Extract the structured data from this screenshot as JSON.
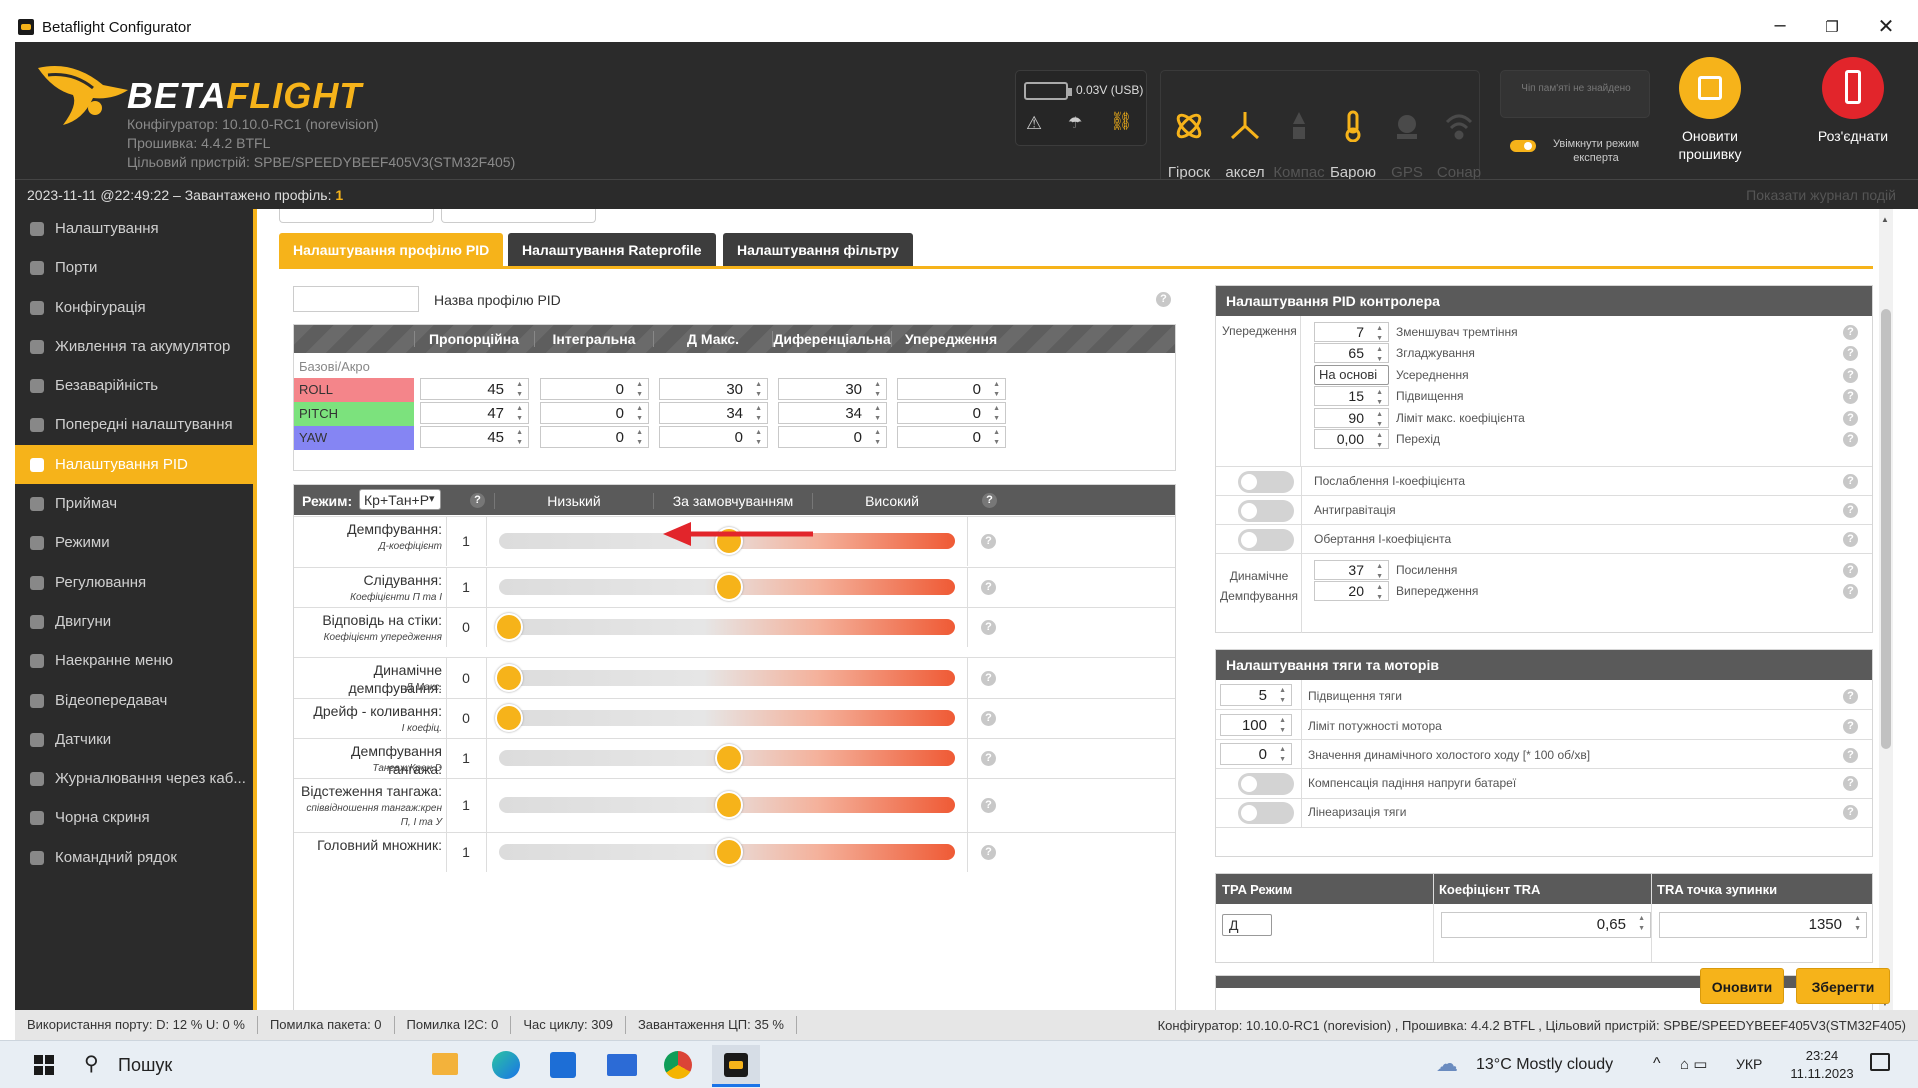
{
  "window": {
    "title": "Betaflight Configurator",
    "minimize": "–",
    "restore": "❐",
    "close": "✕"
  },
  "header": {
    "brand_first": "BETA",
    "brand_second": "FLIGHT",
    "configurator": "Конфігуратор: 10.10.0-RC1 (norevision)",
    "firmware": "Прошивка: 4.4.2 BTFL",
    "target": "Цільовий пристрій: SPBE/SPEEDYBEEF405V3(STM32F405)",
    "voltage": "0.03V (USB)",
    "sensors": [
      "Гіроск",
      "аксел",
      "Компас",
      "Барою",
      "GPS",
      "Сонар"
    ],
    "flash_status": "Чіп пам'яті не знайдено",
    "expert_mode": "Увімкнути режим експерта",
    "update_button": "Оновити прошивку",
    "disconnect_button": "Роз'єднати",
    "colors": {
      "accent": "#f6b31a",
      "disconnect": "#e2252b",
      "header_bg": "#2b2b2b"
    }
  },
  "statusline": {
    "text": "2023-11-11 @22:49:22 – Завантажено профіль:",
    "profile": "1",
    "log_link": "Показати журнал подій"
  },
  "sidebar": {
    "items": [
      {
        "label": "Налаштування",
        "icon": "wrench-icon"
      },
      {
        "label": "Порти",
        "icon": "plug-icon"
      },
      {
        "label": "Конфігурація",
        "icon": "gear-icon"
      },
      {
        "label": "Живлення та акумулятор",
        "icon": "battery-icon"
      },
      {
        "label": "Безаварійність",
        "icon": "parachute-icon"
      },
      {
        "label": "Попередні налаштування",
        "icon": "magic-wand-icon"
      },
      {
        "label": "Налаштування PID",
        "icon": "pid-icon",
        "active": true
      },
      {
        "label": "Приймач",
        "icon": "receiver-icon"
      },
      {
        "label": "Режими",
        "icon": "modes-icon"
      },
      {
        "label": "Регулювання",
        "icon": "sliders-icon"
      },
      {
        "label": "Двигуни",
        "icon": "motor-icon"
      },
      {
        "label": "Наекранне меню",
        "icon": "osd-icon"
      },
      {
        "label": "Відеопередавач",
        "icon": "antenna-icon"
      },
      {
        "label": "Датчики",
        "icon": "sensors-icon"
      },
      {
        "label": "Журналювання через каб...",
        "icon": "blackbox-icon"
      },
      {
        "label": "Чорна скриня",
        "icon": "box-icon"
      },
      {
        "label": "Командний рядок",
        "icon": "terminal-icon"
      }
    ]
  },
  "tabs": [
    "Налаштування профілю PID",
    "Налаштування Rateprofile",
    "Налаштування фільтру"
  ],
  "pid": {
    "profile_name_label": "Назва профілю PID",
    "columns": [
      "Пропорційна",
      "Інтегральна",
      "Д Макс.",
      "Диференціальна",
      "Упередження"
    ],
    "group_label": "Базові/Акро",
    "rows": [
      {
        "axis": "ROLL",
        "color": "#f4858a",
        "values": [
          "45",
          "0",
          "30",
          "30",
          "0"
        ]
      },
      {
        "axis": "PITCH",
        "color": "#7ce27d",
        "values": [
          "47",
          "0",
          "34",
          "34",
          "0"
        ]
      },
      {
        "axis": "YAW",
        "color": "#8585f3",
        "values": [
          "45",
          "0",
          "0",
          "0",
          "0"
        ]
      }
    ]
  },
  "sliders": {
    "mode_label": "Режим:",
    "mode_value": "Кр+Тан+Р",
    "headers": [
      "Низький",
      "За замовчуванням",
      "Високий"
    ],
    "rows": [
      {
        "label": "Демпфування:",
        "sub": "Д-коефіцієнт",
        "value": "1",
        "level": 0.5
      },
      {
        "label": "Слідування:",
        "sub": "Коефіцієнти П та І",
        "value": "1",
        "level": 0.5
      },
      {
        "label": "Відповідь на стіки:",
        "sub": "Коефіцієнт упередження",
        "value": "0",
        "level": 0.0
      },
      {
        "label": "Динамічне демпфування:",
        "sub": "Д Макс.",
        "value": "0",
        "level": 0.0
      },
      {
        "label": "Дрейф - коливання:",
        "sub": "І коефіц.",
        "value": "0",
        "level": 0.0
      },
      {
        "label": "Демпфування тангажа:",
        "sub": "Тангаж:Крен D",
        "value": "1",
        "level": 0.5
      },
      {
        "label": "Відстеження тангажа:",
        "sub": "співвідношення тангаж:крен П, І та У",
        "value": "1",
        "level": 0.5
      },
      {
        "label": "Головний множник:",
        "sub": "",
        "value": "1",
        "level": 0.5
      }
    ]
  },
  "controller": {
    "title": "Налаштування PID контролера",
    "feedforward_label": "Упередження",
    "ff_rows": [
      {
        "value": "7",
        "label": "Зменшувач тремтіння"
      },
      {
        "value": "65",
        "label": "Згладжування"
      },
      {
        "value": "На основі",
        "label": "Усереднення"
      },
      {
        "value": "15",
        "label": "Підвищення"
      },
      {
        "value": "90",
        "label": "Ліміт макс. коефіцієнта"
      },
      {
        "value": "0,00",
        "label": "Перехід"
      }
    ],
    "toggles": [
      "Послаблення І-коефіцієнта",
      "Антигравітація",
      "Обертання І-коефіцієнта"
    ],
    "dyn_label": "Динамічне Демпфування",
    "dyn_rows": [
      {
        "value": "37",
        "label": "Посилення"
      },
      {
        "value": "20",
        "label": "Випередження"
      }
    ]
  },
  "thrust": {
    "title": "Налаштування тяги та моторів",
    "rows": [
      {
        "value": "5",
        "label": "Підвищення тяги"
      },
      {
        "value": "100",
        "label": "Ліміт потужності мотора"
      },
      {
        "value": "0",
        "label": "Значення динамічного холостого ходу [* 100 об/хв]"
      }
    ],
    "toggles": [
      "Компенсація падіння напруги батареї",
      "Лінеаризація тяги"
    ]
  },
  "tpa": {
    "headers": [
      "TPA Режим",
      "Коефіцієнт TRA",
      "TRA точка зупинки"
    ],
    "mode": "Д",
    "rate": "0,65",
    "breakpoint": "1350"
  },
  "footer": {
    "refresh": "Оновити",
    "save": "Зберегти"
  },
  "statusbar": {
    "port": "Використання порту: D: 12 % U: 0 %",
    "packet": "Помилка пакета: 0",
    "i2c": "Помилка I2C: 0",
    "cycle": "Час циклу: 309",
    "cpu": "Завантаження ЦП: 35 %",
    "version": "Конфігуратор: 10.10.0-RC1 (norevision) , Прошивка: 4.4.2 BTFL , Цільовий пристрій: SPBE/SPEEDYBEEF405V3(STM32F405)"
  },
  "taskbar": {
    "search": "Пошук",
    "weather": "13°C  Mostly cloudy",
    "lang": "УКР",
    "time": "23:24",
    "date": "11.11.2023"
  }
}
